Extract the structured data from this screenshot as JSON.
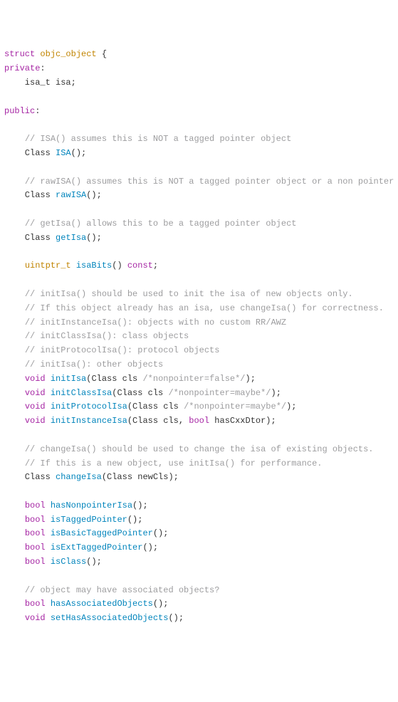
{
  "lines": [
    [
      {
        "c": "k",
        "t": "struct"
      },
      {
        "c": "p",
        "t": " "
      },
      {
        "c": "t",
        "t": "objc_object"
      },
      {
        "c": "p",
        "t": " {"
      }
    ],
    [
      {
        "c": "k",
        "t": "private"
      },
      {
        "c": "p",
        "t": ":"
      }
    ],
    [
      {
        "c": "p",
        "t": "    isa_t isa;"
      }
    ],
    [
      {
        "c": "p",
        "t": ""
      }
    ],
    [
      {
        "c": "k",
        "t": "public"
      },
      {
        "c": "p",
        "t": ":"
      }
    ],
    [
      {
        "c": "p",
        "t": ""
      }
    ],
    [
      {
        "c": "p",
        "t": "    "
      },
      {
        "c": "c",
        "t": "// ISA() assumes this is NOT a tagged pointer object"
      }
    ],
    [
      {
        "c": "p",
        "t": "    Class "
      },
      {
        "c": "f",
        "t": "ISA"
      },
      {
        "c": "p",
        "t": "();"
      }
    ],
    [
      {
        "c": "p",
        "t": ""
      }
    ],
    [
      {
        "c": "p",
        "t": "    "
      },
      {
        "c": "c",
        "t": "// rawISA() assumes this is NOT a tagged pointer object or a non pointer ISA"
      }
    ],
    [
      {
        "c": "p",
        "t": "    Class "
      },
      {
        "c": "f",
        "t": "rawISA"
      },
      {
        "c": "p",
        "t": "();"
      }
    ],
    [
      {
        "c": "p",
        "t": ""
      }
    ],
    [
      {
        "c": "p",
        "t": "    "
      },
      {
        "c": "c",
        "t": "// getIsa() allows this to be a tagged pointer object"
      }
    ],
    [
      {
        "c": "p",
        "t": "    Class "
      },
      {
        "c": "f",
        "t": "getIsa"
      },
      {
        "c": "p",
        "t": "();"
      }
    ],
    [
      {
        "c": "p",
        "t": ""
      }
    ],
    [
      {
        "c": "p",
        "t": "    "
      },
      {
        "c": "t",
        "t": "uintptr_t"
      },
      {
        "c": "p",
        "t": " "
      },
      {
        "c": "f",
        "t": "isaBits"
      },
      {
        "c": "p",
        "t": "() "
      },
      {
        "c": "k",
        "t": "const"
      },
      {
        "c": "p",
        "t": ";"
      }
    ],
    [
      {
        "c": "p",
        "t": ""
      }
    ],
    [
      {
        "c": "p",
        "t": "    "
      },
      {
        "c": "c",
        "t": "// initIsa() should be used to init the isa of new objects only."
      }
    ],
    [
      {
        "c": "p",
        "t": "    "
      },
      {
        "c": "c",
        "t": "// If this object already has an isa, use changeIsa() for correctness."
      }
    ],
    [
      {
        "c": "p",
        "t": "    "
      },
      {
        "c": "c",
        "t": "// initInstanceIsa(): objects with no custom RR/AWZ"
      }
    ],
    [
      {
        "c": "p",
        "t": "    "
      },
      {
        "c": "c",
        "t": "// initClassIsa(): class objects"
      }
    ],
    [
      {
        "c": "p",
        "t": "    "
      },
      {
        "c": "c",
        "t": "// initProtocolIsa(): protocol objects"
      }
    ],
    [
      {
        "c": "p",
        "t": "    "
      },
      {
        "c": "c",
        "t": "// initIsa(): other objects"
      }
    ],
    [
      {
        "c": "p",
        "t": "    "
      },
      {
        "c": "k",
        "t": "void"
      },
      {
        "c": "p",
        "t": " "
      },
      {
        "c": "f",
        "t": "initIsa"
      },
      {
        "c": "p",
        "t": "(Class cls "
      },
      {
        "c": "c",
        "t": "/*nonpointer=false*/"
      },
      {
        "c": "p",
        "t": ");"
      }
    ],
    [
      {
        "c": "p",
        "t": "    "
      },
      {
        "c": "k",
        "t": "void"
      },
      {
        "c": "p",
        "t": " "
      },
      {
        "c": "f",
        "t": "initClassIsa"
      },
      {
        "c": "p",
        "t": "(Class cls "
      },
      {
        "c": "c",
        "t": "/*nonpointer=maybe*/"
      },
      {
        "c": "p",
        "t": ");"
      }
    ],
    [
      {
        "c": "p",
        "t": "    "
      },
      {
        "c": "k",
        "t": "void"
      },
      {
        "c": "p",
        "t": " "
      },
      {
        "c": "f",
        "t": "initProtocolIsa"
      },
      {
        "c": "p",
        "t": "(Class cls "
      },
      {
        "c": "c",
        "t": "/*nonpointer=maybe*/"
      },
      {
        "c": "p",
        "t": ");"
      }
    ],
    [
      {
        "c": "p",
        "t": "    "
      },
      {
        "c": "k",
        "t": "void"
      },
      {
        "c": "p",
        "t": " "
      },
      {
        "c": "f",
        "t": "initInstanceIsa"
      },
      {
        "c": "p",
        "t": "(Class cls, "
      },
      {
        "c": "k",
        "t": "bool"
      },
      {
        "c": "p",
        "t": " hasCxxDtor);"
      }
    ],
    [
      {
        "c": "p",
        "t": ""
      }
    ],
    [
      {
        "c": "p",
        "t": "    "
      },
      {
        "c": "c",
        "t": "// changeIsa() should be used to change the isa of existing objects."
      }
    ],
    [
      {
        "c": "p",
        "t": "    "
      },
      {
        "c": "c",
        "t": "// If this is a new object, use initIsa() for performance."
      }
    ],
    [
      {
        "c": "p",
        "t": "    Class "
      },
      {
        "c": "f",
        "t": "changeIsa"
      },
      {
        "c": "p",
        "t": "(Class newCls);"
      }
    ],
    [
      {
        "c": "p",
        "t": ""
      }
    ],
    [
      {
        "c": "p",
        "t": "    "
      },
      {
        "c": "k",
        "t": "bool"
      },
      {
        "c": "p",
        "t": " "
      },
      {
        "c": "f",
        "t": "hasNonpointerIsa"
      },
      {
        "c": "p",
        "t": "();"
      }
    ],
    [
      {
        "c": "p",
        "t": "    "
      },
      {
        "c": "k",
        "t": "bool"
      },
      {
        "c": "p",
        "t": " "
      },
      {
        "c": "f",
        "t": "isTaggedPointer"
      },
      {
        "c": "p",
        "t": "();"
      }
    ],
    [
      {
        "c": "p",
        "t": "    "
      },
      {
        "c": "k",
        "t": "bool"
      },
      {
        "c": "p",
        "t": " "
      },
      {
        "c": "f",
        "t": "isBasicTaggedPointer"
      },
      {
        "c": "p",
        "t": "();"
      }
    ],
    [
      {
        "c": "p",
        "t": "    "
      },
      {
        "c": "k",
        "t": "bool"
      },
      {
        "c": "p",
        "t": " "
      },
      {
        "c": "f",
        "t": "isExtTaggedPointer"
      },
      {
        "c": "p",
        "t": "();"
      }
    ],
    [
      {
        "c": "p",
        "t": "    "
      },
      {
        "c": "k",
        "t": "bool"
      },
      {
        "c": "p",
        "t": " "
      },
      {
        "c": "f",
        "t": "isClass"
      },
      {
        "c": "p",
        "t": "();"
      }
    ],
    [
      {
        "c": "p",
        "t": ""
      }
    ],
    [
      {
        "c": "p",
        "t": "    "
      },
      {
        "c": "c",
        "t": "// object may have associated objects?"
      }
    ],
    [
      {
        "c": "p",
        "t": "    "
      },
      {
        "c": "k",
        "t": "bool"
      },
      {
        "c": "p",
        "t": " "
      },
      {
        "c": "f",
        "t": "hasAssociatedObjects"
      },
      {
        "c": "p",
        "t": "();"
      }
    ],
    [
      {
        "c": "p",
        "t": "    "
      },
      {
        "c": "k",
        "t": "void"
      },
      {
        "c": "p",
        "t": " "
      },
      {
        "c": "f",
        "t": "setHasAssociatedObjects"
      },
      {
        "c": "p",
        "t": "();"
      }
    ]
  ]
}
